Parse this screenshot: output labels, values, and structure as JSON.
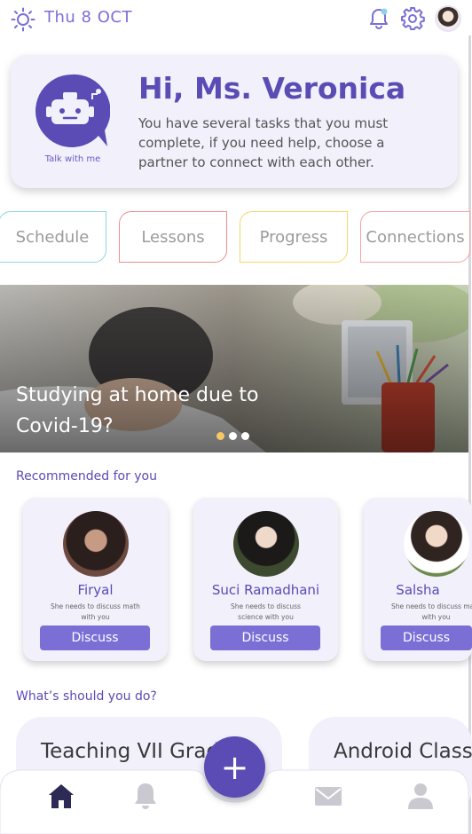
{
  "header": {
    "date": "Thu 8 OCT"
  },
  "greeting": {
    "title": "Hi, Ms. Veronica",
    "message": "You have several tasks that you must complete, if you need help, choose a partner to connect with each other.",
    "bot_caption": "Talk with me"
  },
  "categories": [
    {
      "label": "Schedule",
      "color": "#8fd3e8"
    },
    {
      "label": "Lessons",
      "color": "#f08d8d"
    },
    {
      "label": "Progress",
      "color": "#f6d56b"
    },
    {
      "label": "Connections",
      "color": "#f3a3a3"
    }
  ],
  "hero": {
    "title": "Studying at home due to Covid-19?",
    "slide_count": 3,
    "active_slide": 1
  },
  "recommended": {
    "title": "Recommended for you",
    "items": [
      {
        "name": "Firyal",
        "desc": "She needs to discuss math with you",
        "button": "Discuss"
      },
      {
        "name": "Suci Ramadhani",
        "desc": "She needs to discuss science with you",
        "button": "Discuss"
      },
      {
        "name": "Salsha",
        "desc": "She needs to discuss math with you",
        "button": "Discuss"
      }
    ]
  },
  "tasks": {
    "title": "What’s should you do?",
    "items": [
      {
        "label": "Teaching VII Grade"
      },
      {
        "label": "Android Class"
      }
    ]
  },
  "nav": {
    "fab_symbol": "+",
    "items": [
      "home-icon",
      "bell-icon",
      "mail-icon",
      "user-icon"
    ],
    "active": "home-icon"
  },
  "colors": {
    "accent": "#5a4bb5",
    "accent_light": "#7b6fd6",
    "card_bg": "#f1f0fb"
  }
}
